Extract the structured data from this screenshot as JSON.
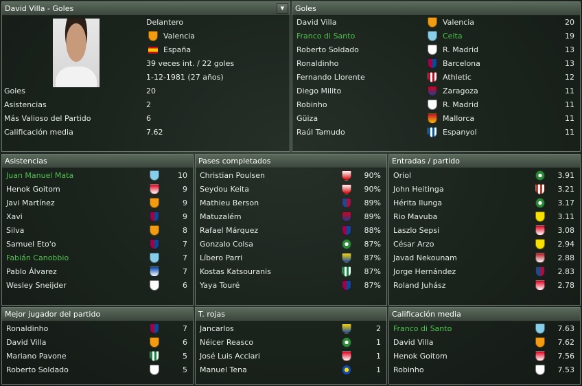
{
  "player_panel": {
    "title": "David Villa - Goles",
    "position": "Delantero",
    "club": "Valencia",
    "nation": "España",
    "caps": "39 veces int. / 22 goles",
    "birth": "1-12-1981 (27 años)",
    "stats": [
      {
        "label": "Goles",
        "value": "20"
      },
      {
        "label": "Asistencias",
        "value": "2"
      },
      {
        "label": "Más Valioso del Partido",
        "value": "6"
      },
      {
        "label": "Calificación media",
        "value": "7.62"
      }
    ]
  },
  "colors": {
    "valencia": "#f39c12",
    "celta": "#87ceeb",
    "madrid": "#ffffff",
    "barcelona": "#a50044",
    "athletic": "#d0021b",
    "zaragoza": "#1e3f8a",
    "mallorca": "#c8102e",
    "espanyol": "#0055a5",
    "sevilla": "#d40000",
    "levante": "#174d8c",
    "racing": "#2e8b3a",
    "cadiz": "#f5d30a",
    "betis": "#0b8a3c",
    "atletico": "#cb3524",
    "villarreal": "#f6e000",
    "sporting": "#e0001b",
    "recreativo": "#1a4ba8",
    "murcia": "#b3151b",
    "deportivo": "#0046ad"
  },
  "goles": {
    "title": "Goles",
    "rows": [
      {
        "player": "David Villa",
        "club": "Valencia",
        "crest": "valencia-crest-icon",
        "value": "20",
        "highlight": false
      },
      {
        "player": "Franco di Santo",
        "club": "Celta",
        "crest": "celta-crest-icon",
        "value": "19",
        "highlight": true
      },
      {
        "player": "Roberto Soldado",
        "club": "R. Madrid",
        "crest": "madrid-crest-icon",
        "value": "13",
        "highlight": false
      },
      {
        "player": "Ronaldinho",
        "club": "Barcelona",
        "crest": "barcelona-crest-icon",
        "value": "13",
        "highlight": false
      },
      {
        "player": "Fernando Llorente",
        "club": "Athletic",
        "crest": "athletic-crest-icon",
        "value": "12",
        "highlight": false
      },
      {
        "player": "Diego Milito",
        "club": "Zaragoza",
        "crest": "zaragoza-crest-icon",
        "value": "11",
        "highlight": false
      },
      {
        "player": "Robinho",
        "club": "R. Madrid",
        "crest": "madrid-crest-icon",
        "value": "11",
        "highlight": false
      },
      {
        "player": "Güiza",
        "club": "Mallorca",
        "crest": "mallorca-crest-icon",
        "value": "11",
        "highlight": false
      },
      {
        "player": "Raúl Tamudo",
        "club": "Espanyol",
        "crest": "espanyol-crest-icon",
        "value": "11",
        "highlight": false
      }
    ]
  },
  "asistencias": {
    "title": "Asistencias",
    "rows": [
      {
        "player": "Juan Manuel Mata",
        "value": "10",
        "highlight": true
      },
      {
        "player": "Henok Goitom",
        "value": "9",
        "highlight": false
      },
      {
        "player": "Javi Martínez",
        "value": "9",
        "highlight": false
      },
      {
        "player": "Xavi",
        "value": "9",
        "highlight": false
      },
      {
        "player": "Silva",
        "value": "8",
        "highlight": false
      },
      {
        "player": "Samuel Eto'o",
        "value": "7",
        "highlight": false
      },
      {
        "player": "Fabián Canobbio",
        "value": "7",
        "highlight": true
      },
      {
        "player": "Pablo Álvarez",
        "value": "7",
        "highlight": false
      },
      {
        "player": "Wesley Sneijder",
        "value": "6",
        "highlight": false
      }
    ]
  },
  "pases": {
    "title": "Pases completados",
    "rows": [
      {
        "player": "Christian Poulsen",
        "value": "90%",
        "highlight": false
      },
      {
        "player": "Seydou Keita",
        "value": "90%",
        "highlight": false
      },
      {
        "player": "Mathieu Berson",
        "value": "89%",
        "highlight": false
      },
      {
        "player": "Matuzalém",
        "value": "89%",
        "highlight": false
      },
      {
        "player": "Rafael Márquez",
        "value": "88%",
        "highlight": false
      },
      {
        "player": "Gonzalo Colsa",
        "value": "87%",
        "highlight": false
      },
      {
        "player": "Líbero Parri",
        "value": "87%",
        "highlight": false
      },
      {
        "player": "Kostas Katsouranis",
        "value": "87%",
        "highlight": false
      },
      {
        "player": "Yaya Touré",
        "value": "87%",
        "highlight": false
      }
    ]
  },
  "entradas": {
    "title": "Entradas / partido",
    "rows": [
      {
        "player": "Oriol",
        "value": "3.91",
        "highlight": false
      },
      {
        "player": "John Heitinga",
        "value": "3.21",
        "highlight": false
      },
      {
        "player": "Hérita Ilunga",
        "value": "3.17",
        "highlight": false
      },
      {
        "player": "Rio Mavuba",
        "value": "3.11",
        "highlight": false
      },
      {
        "player": "Laszlo Sepsi",
        "value": "3.08",
        "highlight": false
      },
      {
        "player": "César Arzo",
        "value": "2.94",
        "highlight": false
      },
      {
        "player": "Javad Nekounam",
        "value": "2.88",
        "highlight": false
      },
      {
        "player": "Jorge Hernández",
        "value": "2.83",
        "highlight": false
      },
      {
        "player": "Roland Juhász",
        "value": "2.78",
        "highlight": false
      }
    ]
  },
  "mejor": {
    "title": "Mejor jugador del partido",
    "rows": [
      {
        "player": "Ronaldinho",
        "value": "7",
        "highlight": false
      },
      {
        "player": "David Villa",
        "value": "6",
        "highlight": false
      },
      {
        "player": "Mariano Pavone",
        "value": "5",
        "highlight": false
      },
      {
        "player": "Roberto Soldado",
        "value": "5",
        "highlight": false
      }
    ]
  },
  "rojas": {
    "title": "T. rojas",
    "rows": [
      {
        "player": "Jancarlos",
        "value": "2",
        "highlight": false
      },
      {
        "player": "Néicer Reasco",
        "value": "1",
        "highlight": false
      },
      {
        "player": "José Luis Acciari",
        "value": "1",
        "highlight": false
      },
      {
        "player": "Manuel Tena",
        "value": "1",
        "highlight": false
      }
    ]
  },
  "calificacion": {
    "title": "Calificación media",
    "rows": [
      {
        "player": "Franco di Santo",
        "value": "7.63",
        "highlight": true
      },
      {
        "player": "David Villa",
        "value": "7.62",
        "highlight": false
      },
      {
        "player": "Henok Goitom",
        "value": "7.56",
        "highlight": false
      },
      {
        "player": "Robinho",
        "value": "7.53",
        "highlight": false
      }
    ]
  }
}
